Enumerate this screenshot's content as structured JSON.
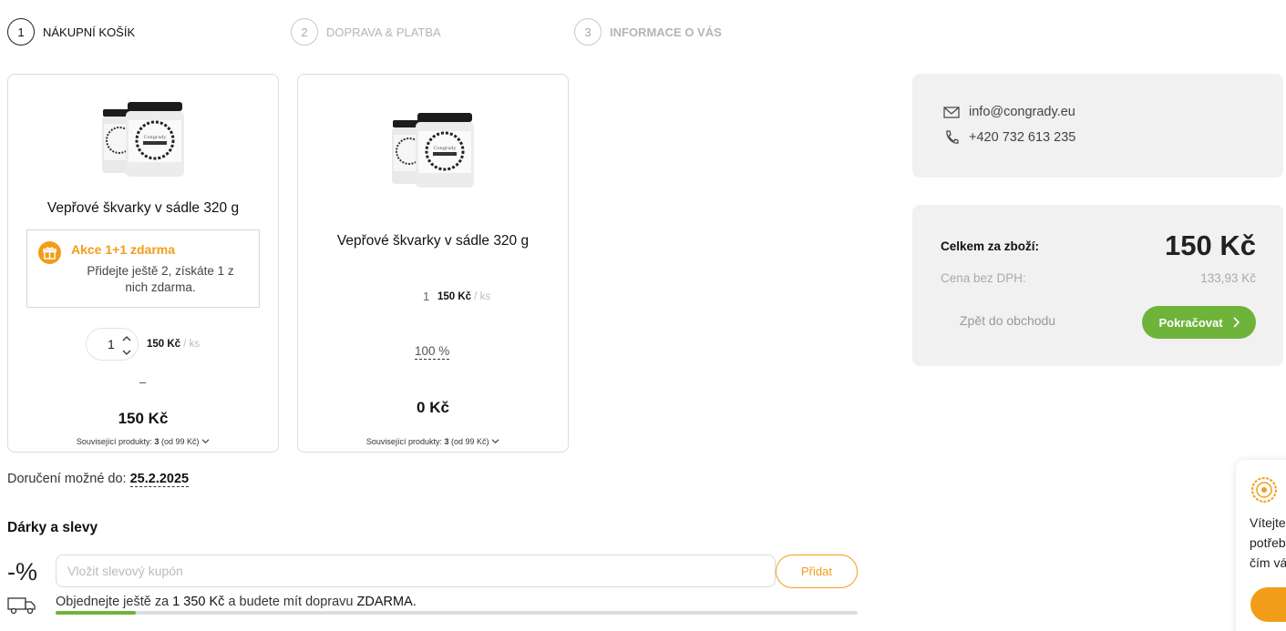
{
  "steps": [
    {
      "number": "1",
      "label": "NÁKUPNÍ KOŠÍK",
      "active": true
    },
    {
      "number": "2",
      "label": "DOPRAVA & PLATBA",
      "active": false
    },
    {
      "number": "3",
      "label": "INFORMACE O VÁS",
      "active": false
    }
  ],
  "cart": {
    "items": [
      {
        "title": "Vepřové škvarky v sádle 320 g",
        "promo_title": "Akce 1+1 zdarma",
        "promo_text": "Přidejte ještě 2, získáte 1 z nich zdarma.",
        "quantity": "1",
        "unit_price": "150 Kč",
        "unit": "/ ks",
        "dash": "–",
        "total": "150 Kč",
        "related_label": "Související produkty:",
        "related_count": "3",
        "related_from": "(od 99 Kč)"
      },
      {
        "title": "Vepřové škvarky v sádle 320 g",
        "quantity": "1",
        "unit_price": "150 Kč",
        "unit": "/ ks",
        "discount": "100 %",
        "total": "0 Kč",
        "related_label": "Související produkty:",
        "related_count": "3",
        "related_from": "(od 99 Kč)"
      }
    ]
  },
  "delivery": {
    "label": "Doručení možné do:",
    "date": "25.2.2025"
  },
  "gifts": {
    "title": "Dárky a slevy",
    "percent_symbol": "-%",
    "coupon_placeholder": "Vložit slevový kupón",
    "add_label": "Přidat",
    "free_shipping_prefix": "Objednejte ještě za",
    "free_shipping_amount": "1 350 Kč",
    "free_shipping_suffix": "a budete mít dopravu",
    "free_shipping_highlight": "ZDARMA.",
    "free_shipping_progress": 0.1
  },
  "contact": {
    "email": "info@congrady.eu",
    "phone": "+420 732 613 235"
  },
  "summary": {
    "total_label": "Celkem za zboží:",
    "total_value": "150 Kč",
    "vat_label": "Cena bez DPH:",
    "vat_value": "133,93 Kč",
    "back_label": "Zpět do obchodu",
    "continue_label": "Pokračovat"
  },
  "chat": {
    "line1": "Vítejte",
    "line2": "potřeb",
    "line3": "čím vá"
  },
  "colors": {
    "accent_orange": "#f29d1a",
    "accent_green": "#6fb43a"
  }
}
